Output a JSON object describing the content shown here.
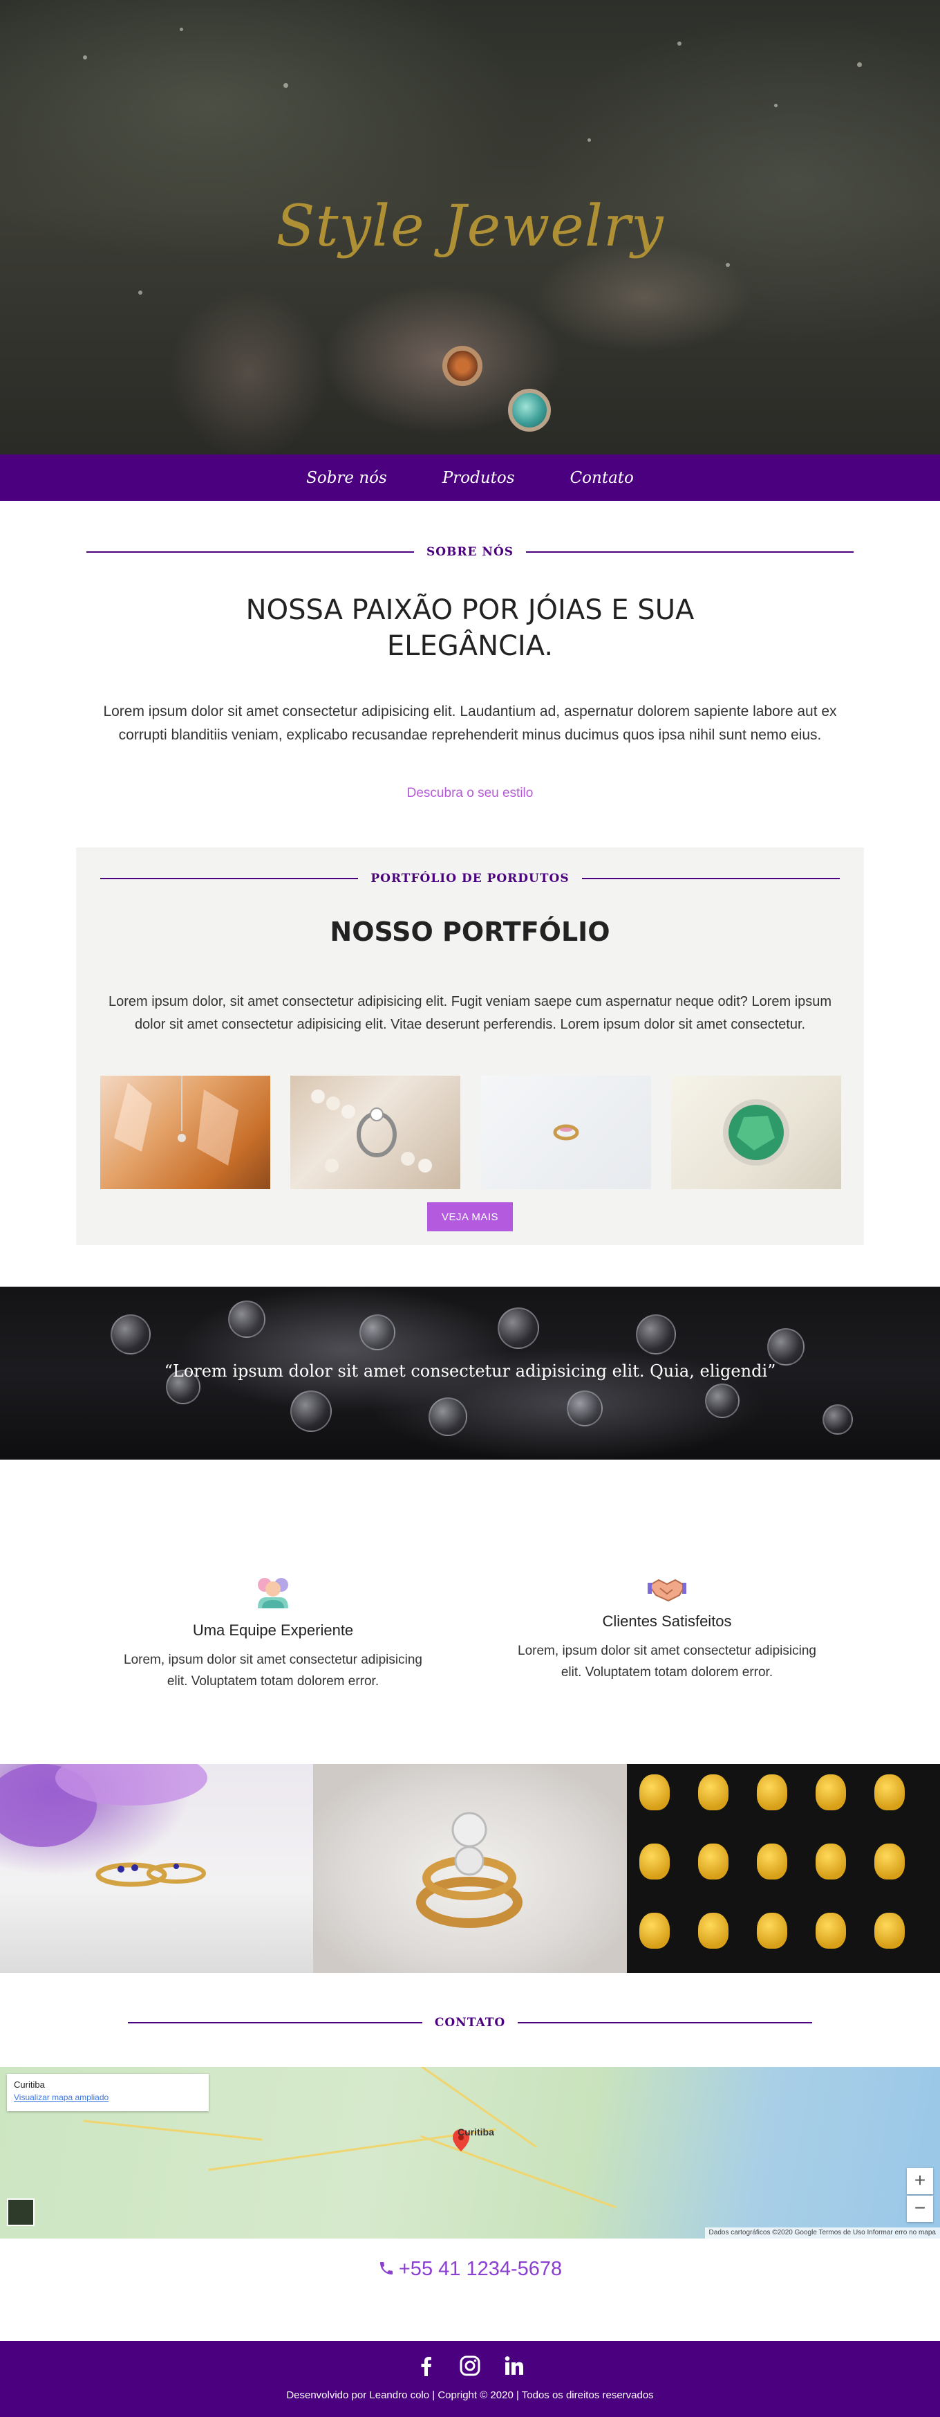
{
  "hero": {
    "title": "Style Jewelry"
  },
  "nav": {
    "items": [
      "Sobre nós",
      "Produtos",
      "Contato"
    ]
  },
  "about": {
    "section_label": "SOBRE NÓS",
    "title": "NOSSA PAIXÃO POR JÓIAS E SUA ELEGÂNCIA.",
    "text": "Lorem ipsum dolor sit amet consectetur adipisicing elit. Laudantium ad, aspernatur dolorem sapiente labore aut ex corrupti blanditiis veniam, explicabo recusandae reprehenderit minus ducimus quos ipsa nihil sunt nemo eius.",
    "link": "Descubra o seu estilo"
  },
  "portfolio": {
    "section_label": "PORTFÓLIO DE PORDUTOS",
    "title": "NOSSO PORTFÓLIO",
    "text": "Lorem ipsum dolor, sit amet consectetur adipisicing elit. Fugit veniam saepe cum aspernatur neque odit? Lorem ipsum dolor sit amet consectetur adipisicing elit. Vitae deserunt perferendis. Lorem ipsum dolor sit amet consectetur.",
    "button": "VEJA MAIS"
  },
  "quote": {
    "text": "“Lorem ipsum dolor sit amet consectetur adipisicing elit. Quia, eligendi”"
  },
  "features": [
    {
      "title": "Uma Equipe Experiente",
      "text": "Lorem, ipsum dolor sit amet consectetur adipisicing elit. Voluptatem totam dolorem error.",
      "icon": "team-icon"
    },
    {
      "title": "Clientes Satisfeitos",
      "text": "Lorem, ipsum dolor sit amet consectetur adipisicing elit. Voluptatem totam dolorem error.",
      "icon": "handshake-icon"
    }
  ],
  "contact": {
    "section_label": "CONTATO",
    "map": {
      "place": "Curitiba",
      "link": "Visualizar mapa ampliado",
      "city_label": "Curitiba",
      "credits": "Dados cartográficos ©2020 Google   Termos de Uso   Informar erro no mapa",
      "zoom_in": "+",
      "zoom_out": "−"
    },
    "phone": "+55 41 1234-5678"
  },
  "footer": {
    "text": "Desenvolvido por Leandro colo | Copright © 2020 | Todos os direitos reservados",
    "socials": [
      "facebook-icon",
      "instagram-icon",
      "linkedin-icon"
    ]
  },
  "colors": {
    "brand_purple": "#4b0080",
    "accent_violet": "#b45ade",
    "gold": "#b09035"
  }
}
